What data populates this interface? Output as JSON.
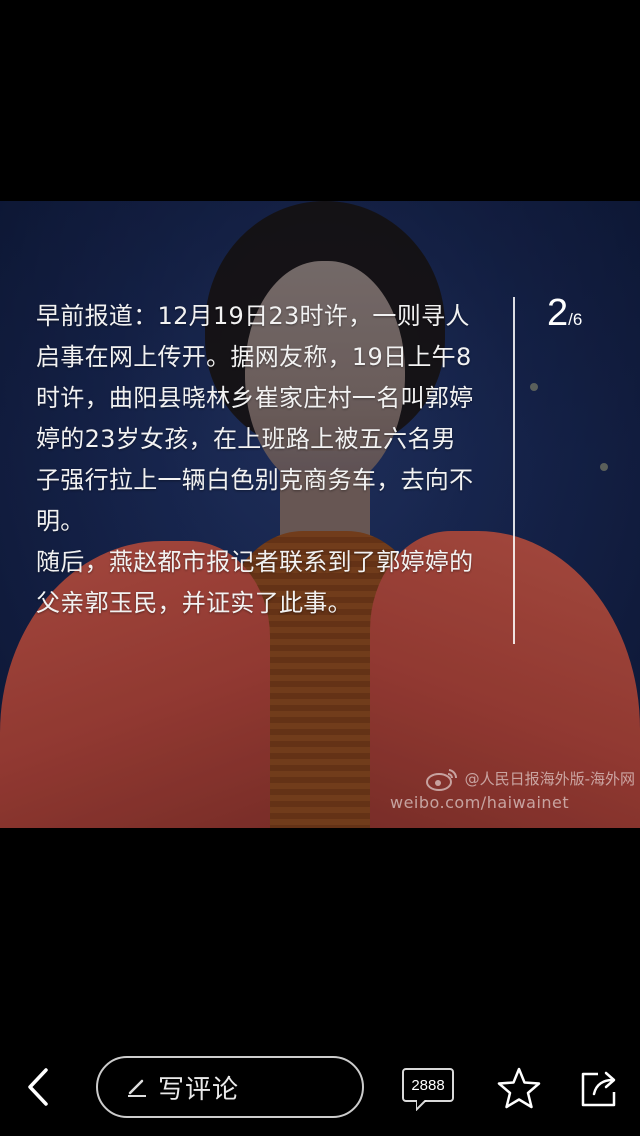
{
  "caption": {
    "paragraph1": "早前报道：12月19日23时许，一则寻人启事在网上传开。据网友称，19日上午8时许，曲阳县晓林乡崔家庄村一名叫郭婷婷的23岁女孩，在上班路上被五六名男子强行拉上一辆白色别克商务车，去向不明。",
    "paragraph2": "随后，燕赵都市报记者联系到了郭婷婷的父亲郭玉民，并证实了此事。"
  },
  "counter": {
    "current": "2",
    "total": "/6"
  },
  "watermark": {
    "line1": "@人民日报海外版-海外网",
    "line2": "weibo.com/haiwainet"
  },
  "toolbar": {
    "comment_label": "写评论",
    "comment_count": "2888"
  },
  "icons": {
    "back": "chevron-left-icon",
    "pen": "pen-icon",
    "comment": "comment-bubble-icon",
    "favorite": "star-icon",
    "share": "share-icon",
    "weibo": "weibo-logo-icon"
  }
}
